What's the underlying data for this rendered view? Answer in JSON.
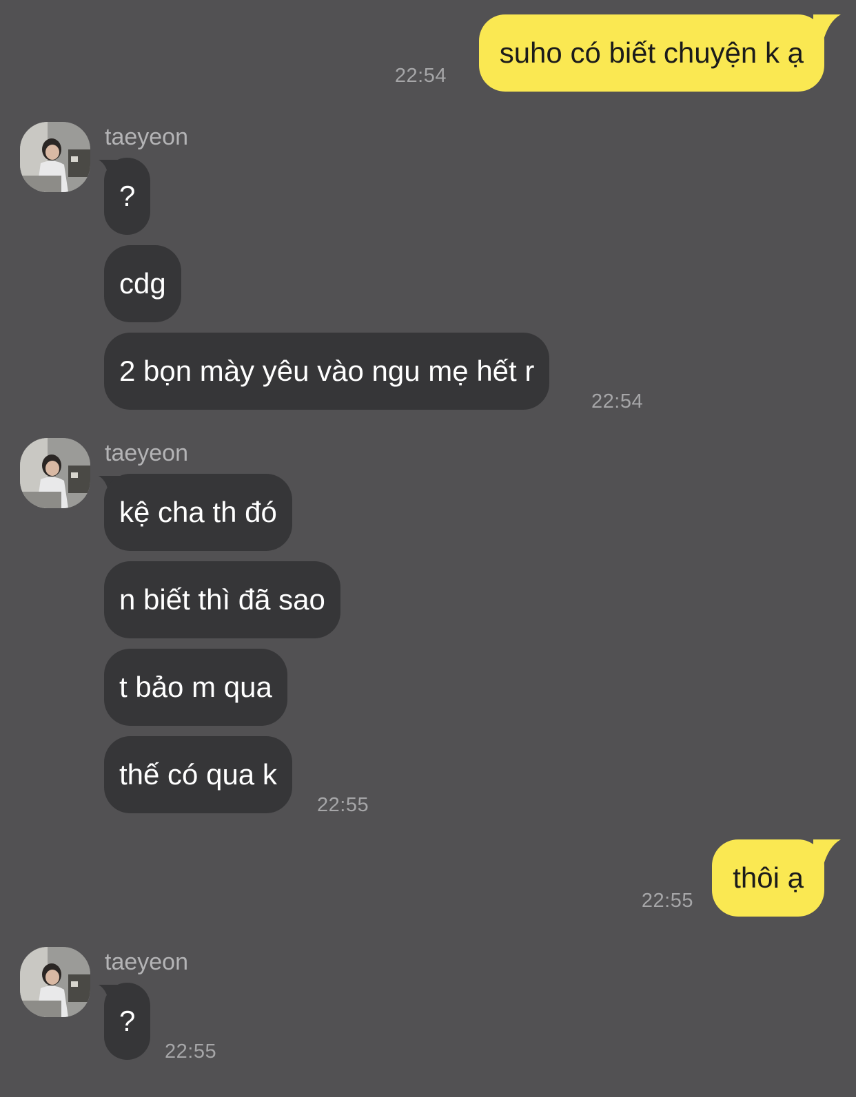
{
  "contact": {
    "name": "taeyeon"
  },
  "messages": {
    "m1": {
      "text": "suho có biết chuyện k ạ",
      "time": "22:54"
    },
    "g1": {
      "sender": "taeyeon",
      "b1": "?",
      "b2": "cdg",
      "b3": "2 bọn mày yêu vào ngu mẹ hết r",
      "time": "22:54"
    },
    "g2": {
      "sender": "taeyeon",
      "b1": "kệ cha th đó",
      "b2": "n biết thì đã sao",
      "b3": "t bảo m qua",
      "b4": "thế có qua k",
      "time": "22:55"
    },
    "m2": {
      "text": "thôi ạ",
      "time": "22:55"
    },
    "g3": {
      "sender": "taeyeon",
      "b1": "?",
      "time": "22:55"
    }
  },
  "colors": {
    "background": "#525153",
    "outgoing_bubble": "#fae852",
    "incoming_bubble": "#363638",
    "timestamp": "#a6a6a8"
  },
  "icons": {
    "avatar": "profile-photo-avatar"
  }
}
